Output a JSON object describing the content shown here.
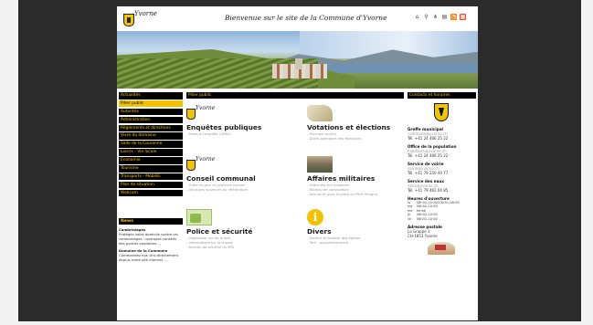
{
  "header": {
    "logo_text": "Yvorne",
    "title": "Bienvenue sur le site de la Commune d'Yvorne",
    "tools": [
      {
        "icon": "home-icon",
        "glyph": "⌂"
      },
      {
        "icon": "search-icon",
        "glyph": "⚲"
      },
      {
        "icon": "sitemap-icon",
        "glyph": "⋔"
      },
      {
        "icon": "print-icon",
        "glyph": "▤"
      },
      {
        "icon": "rss-icon",
        "glyph": "◔"
      },
      {
        "icon": "map-icon",
        "glyph": "▦"
      }
    ]
  },
  "nav": {
    "items": [
      {
        "label": "Actualités",
        "active": false
      },
      {
        "label": "Pilier public",
        "active": true
      },
      {
        "label": "Autorités",
        "active": false
      },
      {
        "label": "Administration",
        "active": false
      },
      {
        "label": "Règlements et directives",
        "active": false
      },
      {
        "label": "Vivre du domaine",
        "active": false
      },
      {
        "label": "Salle de la Couronne",
        "active": false
      },
      {
        "label": "Loisirs - Vie locale",
        "active": false
      },
      {
        "label": "Economie",
        "active": false
      },
      {
        "label": "Tourisme",
        "active": false
      },
      {
        "label": "Transports - MobiliG",
        "active": false
      },
      {
        "label": "Plan de situation",
        "active": false
      },
      {
        "label": "Webcam",
        "active": false
      }
    ]
  },
  "news": {
    "heading": "News",
    "items": [
      {
        "title": "Cambriolages",
        "text": "Protégez votre domicile contre les cambriolages : quelques conseils des polices vaudoises ..."
      },
      {
        "title": "Domaine de la Commune",
        "text": "Commandez nos vins directement depuis notre site internet ..."
      }
    ]
  },
  "breadcrumb": "Pilier public",
  "cards": [
    {
      "title": "Enquêtes publiques",
      "links": [
        "- Mises à l'enquête CAMAC"
      ],
      "image": "logo"
    },
    {
      "title": "Votations et élections",
      "links": [
        "- Prochain scrutin",
        "- Droits politiques des étrangers"
      ],
      "image": "ballot"
    },
    {
      "title": "Conseil communal",
      "links": [
        "- Ordre du jour du prochain conseil",
        "- Décisions soumises au référendum"
      ],
      "image": "logo"
    },
    {
      "title": "Affaires militaires",
      "links": [
        "- Ordre des tirs militaires",
        "- Tableau de convocation",
        "- Avis de tir pour la place du Petit Hongrin"
      ],
      "image": "army"
    },
    {
      "title": "Police et sécurité",
      "links": [
        "- Législation sur les armes",
        "- Informations sur la chasse",
        "- Bulletin de sécurité du BPA"
      ],
      "image": "police"
    },
    {
      "title": "Divers",
      "links": [
        "- Horaire du battant des églises",
        "- Tarif - assujettissement"
      ],
      "image": "info"
    }
  ],
  "contact": {
    "heading": "Contacts et horaires",
    "sections": [
      {
        "title": "Greffe municipal",
        "lines": [
          "commune@yvorne.ch",
          "Tél. +41 24 466 25 22"
        ]
      },
      {
        "title": "Office de la population",
        "lines": [
          "habitants@yvorne.ch",
          "Tél. +41 24 466 25 22"
        ]
      },
      {
        "title": "Service de voirie",
        "lines": [
          "voirie@yvorne.ch",
          "Tél. +41 79 250 40 77"
        ]
      },
      {
        "title": "Service des eaux",
        "lines": [
          "eaux@yvorne.ch",
          "Tél. +41 79 462 04 85"
        ]
      }
    ],
    "hours_title": "Heures d'ouverture",
    "hours": [
      {
        "day": "lu",
        "time": "08h30-11h30/13h30-16h30"
      },
      {
        "day": "ma",
        "time": "08h30-11h30"
      },
      {
        "day": "me",
        "time": "fermé"
      },
      {
        "day": "je",
        "time": "08h30-11h30"
      },
      {
        "day": "ve",
        "time": "08h30-11h30"
      }
    ],
    "address_title": "Adresse postale",
    "address": [
      "La Grappe 3",
      "CH-1853 Yvorne"
    ]
  }
}
